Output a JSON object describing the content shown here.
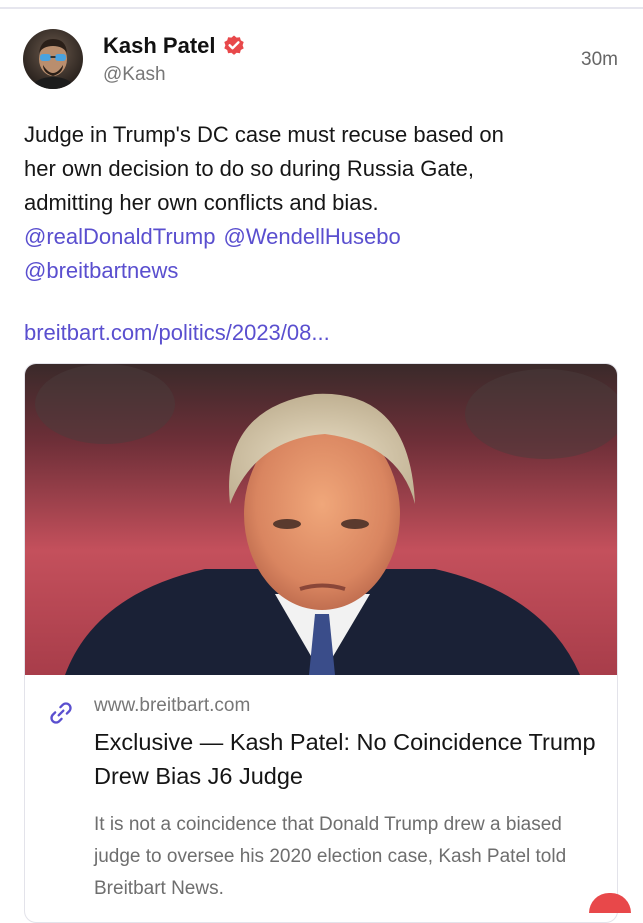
{
  "topbar": {},
  "post": {
    "author_name": "Kash Patel",
    "author_handle": "@Kash",
    "timestamp": "30m",
    "verified_icon": "verified-badge-icon",
    "body_lines": [
      "Judge in Trump's DC case must recuse based on",
      "her own decision to do so during Russia Gate,",
      "admitting her own conflicts and bias."
    ],
    "mentions_line1": [
      "@realDonaldTrump",
      "@WendellHusebo"
    ],
    "mentions_line2": [
      "@breitbartnews"
    ],
    "link_url": "breitbart.com/politics/2023/08...",
    "accent_color": "#5a4fcf",
    "verified_color": "#e8484a"
  },
  "link_card": {
    "domain": "www.breitbart.com",
    "title": "Exclusive — Kash Patel: No Coincidence Trump Drew Bias J6 Judge",
    "description": "It is not a coincidence that Donald Trump drew a biased judge to oversee his 2020 election case, Kash Patel told Breitbart News.",
    "link_icon": "link-chain-icon"
  }
}
